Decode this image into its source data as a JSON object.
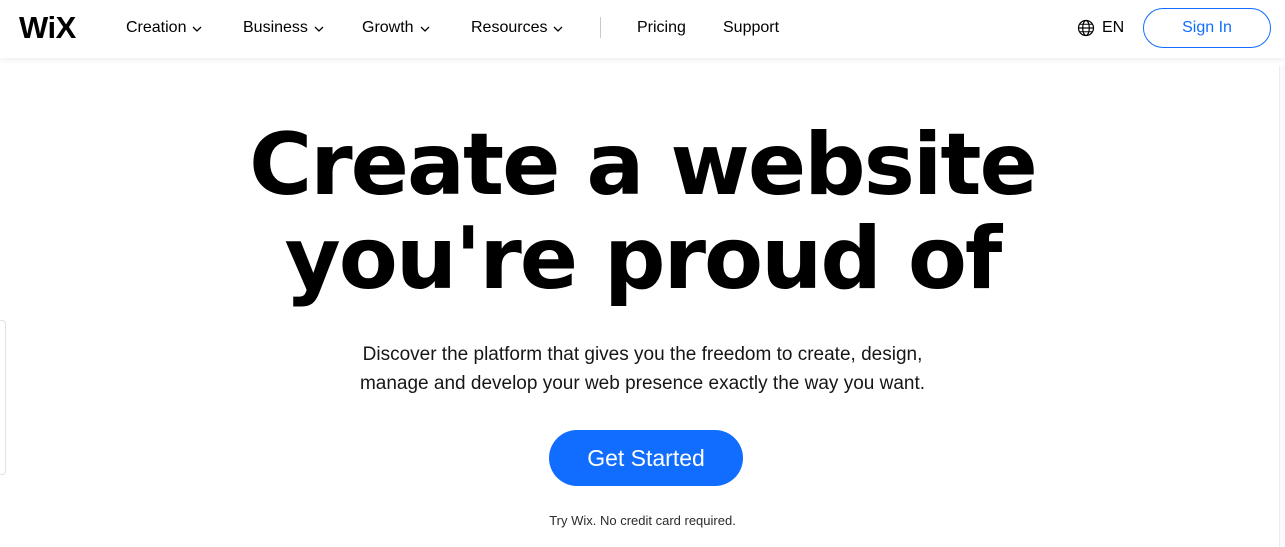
{
  "header": {
    "logo_text": "WiX",
    "nav": [
      {
        "label": "Creation",
        "has_dropdown": true
      },
      {
        "label": "Business",
        "has_dropdown": true
      },
      {
        "label": "Growth",
        "has_dropdown": true
      },
      {
        "label": "Resources",
        "has_dropdown": true
      },
      {
        "label": "Pricing",
        "has_dropdown": false
      },
      {
        "label": "Support",
        "has_dropdown": false
      }
    ],
    "language": {
      "icon": "globe-icon",
      "label": "EN"
    },
    "sign_in_label": "Sign In"
  },
  "hero": {
    "title_line1": "Create a website",
    "title_line2": "you're proud of",
    "subtitle_line1": "Discover the platform that gives you the freedom to create, design,",
    "subtitle_line2": "manage and develop your web presence exactly the way you want.",
    "cta_label": "Get Started",
    "note": "Try Wix. No credit card required."
  },
  "colors": {
    "accent": "#116dff",
    "text": "#000000",
    "background": "#ffffff"
  }
}
